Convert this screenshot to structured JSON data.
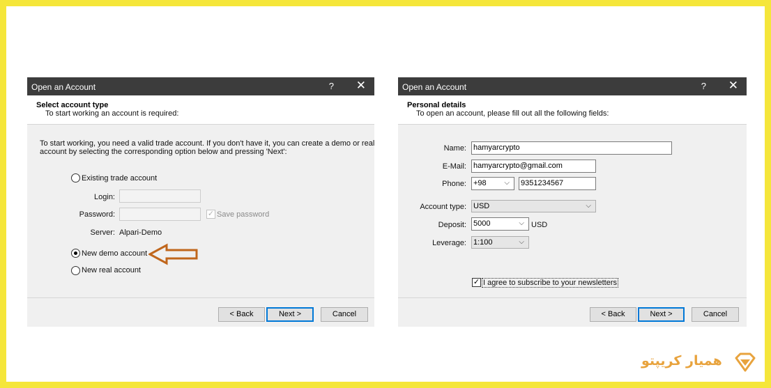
{
  "left_dialog": {
    "title": "Open an Account",
    "help": "?",
    "close": "✕",
    "header_title": "Select account type",
    "header_subtitle": "To start working an account is required:",
    "intro_line1": "To start working, you need a valid trade account. If you don't have it, you can create a demo or real",
    "intro_line2": "account by selecting the corresponding option below and pressing 'Next':",
    "option_existing": "Existing trade account",
    "login_label": "Login:",
    "password_label": "Password:",
    "save_password": "Save password",
    "server_label": "Server:",
    "server_value": "Alpari-Demo",
    "option_demo": "New demo account",
    "option_real": "New real account",
    "back": "< Back",
    "next": "Next >",
    "cancel": "Cancel",
    "arrow_color": "#c0661c"
  },
  "right_dialog": {
    "title": "Open an Account",
    "help": "?",
    "close": "✕",
    "header_title": "Personal details",
    "header_subtitle": "To open an account, please fill out all the following fields:",
    "name_label": "Name:",
    "name_value": "hamyarcrypto",
    "email_label": "E-Mail:",
    "email_value": "hamyarcrypto@gmail.com",
    "phone_label": "Phone:",
    "phone_code": "+98",
    "phone_number": "9351234567",
    "account_type_label": "Account type:",
    "account_type_value": "USD",
    "deposit_label": "Deposit:",
    "deposit_value": "5000",
    "deposit_currency": "USD",
    "leverage_label": "Leverage:",
    "leverage_value": "1:100",
    "newsletter": "I agree to subscribe to your newsletters",
    "back": "< Back",
    "next": "Next >",
    "cancel": "Cancel"
  },
  "brand": {
    "text": "همیار کریپتو",
    "color": "#e8a33d"
  }
}
